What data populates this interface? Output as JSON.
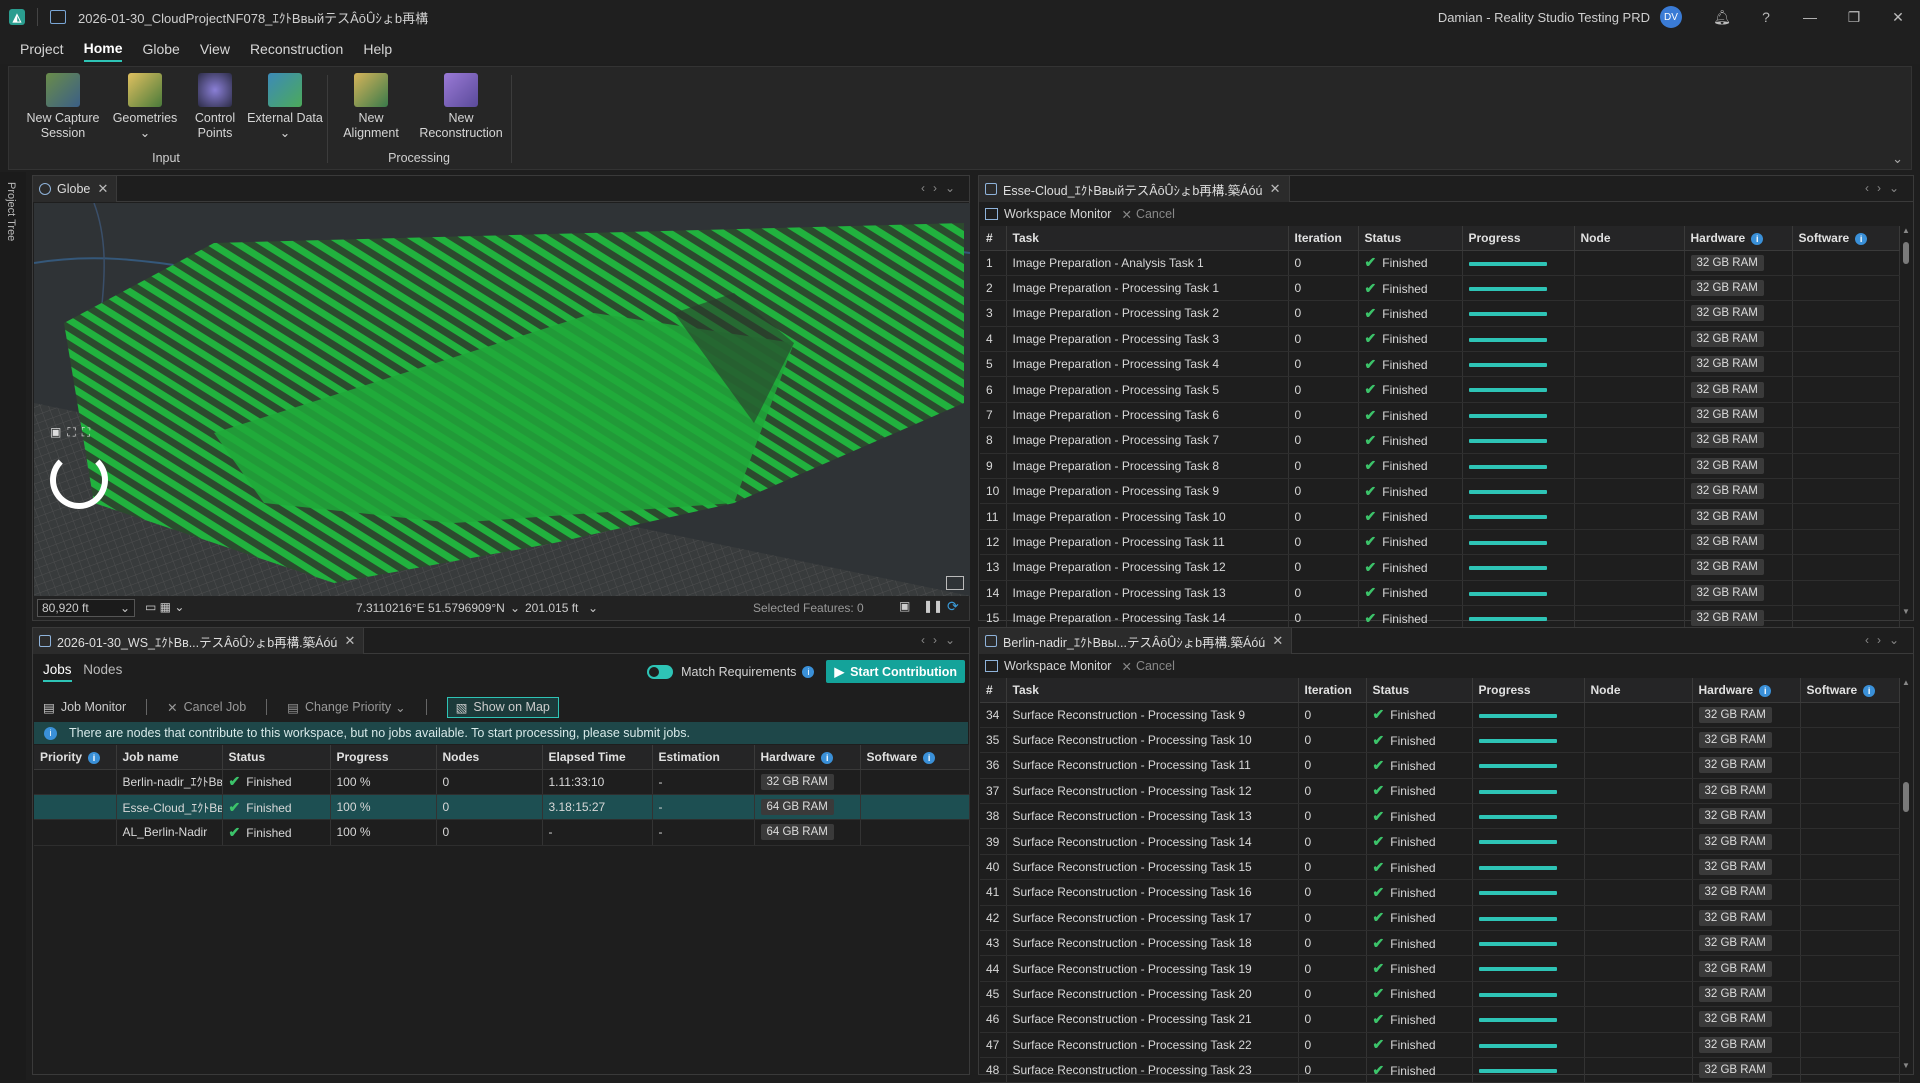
{
  "titlebar": {
    "title": "2026-01-30_CloudProjectNF078_ｴｸﾄBвыйテスÂōÛｼょb再構",
    "user": "Damian - Reality Studio Testing PRD",
    "avatar": "DV"
  },
  "menu": [
    "Project",
    "Home",
    "Globe",
    "View",
    "Reconstruction",
    "Help"
  ],
  "ribbon": {
    "input": {
      "label": "Input",
      "buttons": [
        "New Capture Session",
        "Geometries",
        "Control Points",
        "External Data"
      ]
    },
    "processing": {
      "label": "Processing",
      "buttons": [
        "New Alignment",
        "New Reconstruction"
      ]
    }
  },
  "sidestrip_label": "Project Tree",
  "globe": {
    "tab": "Globe",
    "altitude": "80,920 ft",
    "coords": "7.3110216°E 51.5796909°N",
    "elevation": "201.015 ft",
    "selected_features": "Selected Features: 0"
  },
  "jobs": {
    "tab": "2026-01-30_WS_ｴｸﾄBв...テスÂōÛｼょb再構.築Áóú",
    "tabs": [
      "Jobs",
      "Nodes"
    ],
    "match_requirements": "Match Requirements",
    "start_contribution": "Start Contribution",
    "toolbar": {
      "job_monitor": "Job Monitor",
      "cancel_job": "Cancel Job",
      "change_priority": "Change Priority",
      "show_on_map": "Show on Map"
    },
    "info": "There are nodes that contribute to this workspace, but no jobs available. To start processing, please submit jobs.",
    "columns": [
      "Priority",
      "Job name",
      "Status",
      "Progress",
      "Nodes",
      "Elapsed Time",
      "Estimation",
      "Hardware",
      "Software"
    ],
    "rows": [
      {
        "name": "Berlin-nadir_ｴｸﾄBв",
        "status": "Finished",
        "progress": "100 %",
        "nodes": "0",
        "elapsed": "1.11:33:10",
        "estimation": "-",
        "hardware": "32 GB RAM"
      },
      {
        "name": "Esse-Cloud_ｴｸﾄBв",
        "status": "Finished",
        "progress": "100 %",
        "nodes": "0",
        "elapsed": "3.18:15:27",
        "estimation": "-",
        "hardware": "64 GB RAM"
      },
      {
        "name": "AL_Berlin-Nadir",
        "status": "Finished",
        "progress": "100 %",
        "nodes": "0",
        "elapsed": "-",
        "estimation": "-",
        "hardware": "64 GB RAM"
      }
    ]
  },
  "monitor1": {
    "tab": "Esse-Cloud_ｴｸﾄBвыйテスÂōÛｼょb再構.築Áóú",
    "title": "Workspace Monitor",
    "cancel": "Cancel",
    "columns": [
      "#",
      "Task",
      "Iteration",
      "Status",
      "Progress",
      "Node",
      "Hardware",
      "Software"
    ],
    "rows": [
      {
        "n": "1",
        "task": "Image Preparation - Analysis Task 1"
      },
      {
        "n": "2",
        "task": "Image Preparation - Processing Task 1"
      },
      {
        "n": "3",
        "task": "Image Preparation - Processing Task 2"
      },
      {
        "n": "4",
        "task": "Image Preparation - Processing Task 3"
      },
      {
        "n": "5",
        "task": "Image Preparation - Processing Task 4"
      },
      {
        "n": "6",
        "task": "Image Preparation - Processing Task 5"
      },
      {
        "n": "7",
        "task": "Image Preparation - Processing Task 6"
      },
      {
        "n": "8",
        "task": "Image Preparation - Processing Task 7"
      },
      {
        "n": "9",
        "task": "Image Preparation - Processing Task 8"
      },
      {
        "n": "10",
        "task": "Image Preparation - Processing Task 9"
      },
      {
        "n": "11",
        "task": "Image Preparation - Processing Task 10"
      },
      {
        "n": "12",
        "task": "Image Preparation - Processing Task 11"
      },
      {
        "n": "13",
        "task": "Image Preparation - Processing Task 12"
      },
      {
        "n": "14",
        "task": "Image Preparation - Processing Task 13"
      },
      {
        "n": "15",
        "task": "Image Preparation - Processing Task 14"
      }
    ],
    "iteration": "0",
    "status": "Finished",
    "hardware": "32 GB RAM"
  },
  "monitor2": {
    "tab": "Berlin-nadir_ｴｸﾄBвы...テスÂōÛｼょb再構.築Áóú",
    "title": "Workspace Monitor",
    "cancel": "Cancel",
    "columns": [
      "#",
      "Task",
      "Iteration",
      "Status",
      "Progress",
      "Node",
      "Hardware",
      "Software"
    ],
    "rows": [
      {
        "n": "34",
        "task": "Surface Reconstruction - Processing Task 9"
      },
      {
        "n": "35",
        "task": "Surface Reconstruction - Processing Task 10"
      },
      {
        "n": "36",
        "task": "Surface Reconstruction - Processing Task 11"
      },
      {
        "n": "37",
        "task": "Surface Reconstruction - Processing Task 12"
      },
      {
        "n": "38",
        "task": "Surface Reconstruction - Processing Task 13"
      },
      {
        "n": "39",
        "task": "Surface Reconstruction - Processing Task 14"
      },
      {
        "n": "40",
        "task": "Surface Reconstruction - Processing Task 15"
      },
      {
        "n": "41",
        "task": "Surface Reconstruction - Processing Task 16"
      },
      {
        "n": "42",
        "task": "Surface Reconstruction - Processing Task 17"
      },
      {
        "n": "43",
        "task": "Surface Reconstruction - Processing Task 18"
      },
      {
        "n": "44",
        "task": "Surface Reconstruction - Processing Task 19"
      },
      {
        "n": "45",
        "task": "Surface Reconstruction - Processing Task 20"
      },
      {
        "n": "46",
        "task": "Surface Reconstruction - Processing Task 21"
      },
      {
        "n": "47",
        "task": "Surface Reconstruction - Processing Task 22"
      },
      {
        "n": "48",
        "task": "Surface Reconstruction - Processing Task 23"
      }
    ],
    "iteration": "0",
    "status": "Finished",
    "hardware": "32 GB RAM"
  },
  "colors": {
    "accent": "#2ec4b6",
    "finished": "#3cc36a",
    "capture_green": "#22b43c"
  }
}
